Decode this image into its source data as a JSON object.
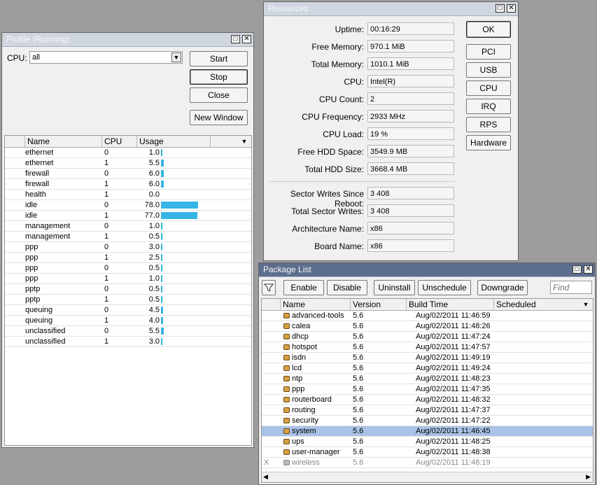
{
  "profile": {
    "title": "Profile (Running)",
    "cpu_label": "CPU:",
    "cpu_value": "all",
    "buttons": {
      "start": "Start",
      "stop": "Stop",
      "close": "Close",
      "new_window": "New Window"
    },
    "columns": [
      "Name",
      "CPU",
      "Usage"
    ],
    "rows": [
      {
        "name": "ethernet",
        "cpu": "0",
        "usage": "1.0",
        "level": 1.0
      },
      {
        "name": "ethernet",
        "cpu": "1",
        "usage": "5.5",
        "level": 5.5
      },
      {
        "name": "firewall",
        "cpu": "0",
        "usage": "6.0",
        "level": 6.0
      },
      {
        "name": "firewall",
        "cpu": "1",
        "usage": "6.0",
        "level": 6.0
      },
      {
        "name": "health",
        "cpu": "1",
        "usage": "0.0",
        "level": 0.0
      },
      {
        "name": "idle",
        "cpu": "0",
        "usage": "78.0",
        "level": 78.0
      },
      {
        "name": "idle",
        "cpu": "1",
        "usage": "77.0",
        "level": 77.0
      },
      {
        "name": "management",
        "cpu": "0",
        "usage": "1.0",
        "level": 1.0
      },
      {
        "name": "management",
        "cpu": "1",
        "usage": "0.5",
        "level": 0.5
      },
      {
        "name": "ppp",
        "cpu": "0",
        "usage": "3.0",
        "level": 3.0
      },
      {
        "name": "ppp",
        "cpu": "1",
        "usage": "2.5",
        "level": 2.5
      },
      {
        "name": "ppp",
        "cpu": "0",
        "usage": "0.5",
        "level": 0.5
      },
      {
        "name": "ppp",
        "cpu": "1",
        "usage": "1.0",
        "level": 1.0
      },
      {
        "name": "pptp",
        "cpu": "0",
        "usage": "0.5",
        "level": 0.5
      },
      {
        "name": "pptp",
        "cpu": "1",
        "usage": "0.5",
        "level": 0.5
      },
      {
        "name": "queuing",
        "cpu": "0",
        "usage": "4.5",
        "level": 4.5
      },
      {
        "name": "queuing",
        "cpu": "1",
        "usage": "4.0",
        "level": 4.0
      },
      {
        "name": "unclassified",
        "cpu": "0",
        "usage": "5.5",
        "level": 5.5
      },
      {
        "name": "unclassified",
        "cpu": "1",
        "usage": "3.0",
        "level": 3.0
      }
    ],
    "bar_color": "#36b5e6"
  },
  "resources": {
    "title": "Resources",
    "fields": [
      {
        "label": "Uptime:",
        "value": "00:16:29"
      },
      {
        "label": "Free Memory:",
        "value": "970.1 MiB"
      },
      {
        "label": "Total Memory:",
        "value": "1010.1 MiB"
      },
      {
        "label": "CPU:",
        "value": "Intel(R)"
      },
      {
        "label": "CPU Count:",
        "value": "2"
      },
      {
        "label": "CPU Frequency:",
        "value": "2933 MHz"
      },
      {
        "label": "CPU Load:",
        "value": "19 %"
      },
      {
        "label": "Free HDD Space:",
        "value": "3549.9 MB"
      },
      {
        "label": "Total HDD Size:",
        "value": "3668.4 MB"
      }
    ],
    "fields2": [
      {
        "label": "Sector Writes Since Reboot:",
        "value": "3 408"
      },
      {
        "label": "Total Sector Writes:",
        "value": "3 408"
      },
      {
        "label": "Architecture Name:",
        "value": "x86"
      },
      {
        "label": "Board Name:",
        "value": "x86"
      }
    ],
    "buttons": [
      "OK",
      "PCI",
      "USB",
      "CPU",
      "IRQ",
      "RPS",
      "Hardware"
    ]
  },
  "packages": {
    "title": "Package List",
    "toolbar": {
      "enable": "Enable",
      "disable": "Disable",
      "uninstall": "Uninstall",
      "unschedule": "Unschedule",
      "downgrade": "Downgrade",
      "find_placeholder": "Find"
    },
    "columns": [
      "Name",
      "Version",
      "Build Time",
      "Scheduled"
    ],
    "rows": [
      {
        "flag": "",
        "name": "advanced-tools",
        "version": "5.6",
        "build": "Aug/02/2011 11:46:59"
      },
      {
        "flag": "",
        "name": "calea",
        "version": "5.6",
        "build": "Aug/02/2011 11:48:26"
      },
      {
        "flag": "",
        "name": "dhcp",
        "version": "5.6",
        "build": "Aug/02/2011 11:47:24"
      },
      {
        "flag": "",
        "name": "hotspot",
        "version": "5.6",
        "build": "Aug/02/2011 11:47:57"
      },
      {
        "flag": "",
        "name": "isdn",
        "version": "5.6",
        "build": "Aug/02/2011 11:49:19"
      },
      {
        "flag": "",
        "name": "lcd",
        "version": "5.6",
        "build": "Aug/02/2011 11:49:24"
      },
      {
        "flag": "",
        "name": "ntp",
        "version": "5.6",
        "build": "Aug/02/2011 11:48:23"
      },
      {
        "flag": "",
        "name": "ppp",
        "version": "5.6",
        "build": "Aug/02/2011 11:47:35"
      },
      {
        "flag": "",
        "name": "routerboard",
        "version": "5.6",
        "build": "Aug/02/2011 11:48:32"
      },
      {
        "flag": "",
        "name": "routing",
        "version": "5.6",
        "build": "Aug/02/2011 11:47:37"
      },
      {
        "flag": "",
        "name": "security",
        "version": "5.6",
        "build": "Aug/02/2011 11:47:22"
      },
      {
        "flag": "",
        "name": "system",
        "version": "5.6",
        "build": "Aug/02/2011 11:46:45",
        "selected": true
      },
      {
        "flag": "",
        "name": "ups",
        "version": "5.6",
        "build": "Aug/02/2011 11:48:25"
      },
      {
        "flag": "",
        "name": "user-manager",
        "version": "5.6",
        "build": "Aug/02/2011 11:48:38"
      },
      {
        "flag": "X",
        "name": "wireless",
        "version": "5.6",
        "build": "Aug/02/2011 11:48:19",
        "disabled": true
      }
    ]
  }
}
